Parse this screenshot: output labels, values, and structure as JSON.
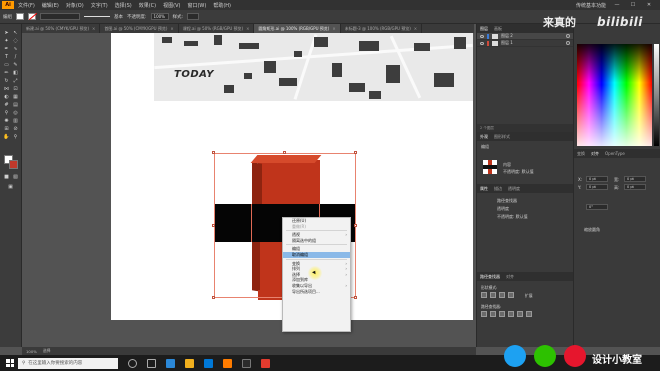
{
  "menubar": {
    "app_logo": "Ai",
    "items": [
      "文件(F)",
      "编辑(E)",
      "对象(O)",
      "文字(T)",
      "选择(S)",
      "效果(C)",
      "视图(V)",
      "窗口(W)",
      "帮助(H)"
    ],
    "workspace": "传统基本功能",
    "min": "—",
    "max": "☐",
    "close": "✕"
  },
  "control_bar": {
    "selection_label": "编组",
    "stroke_weight": "基本",
    "opacity_label": "不透明度:",
    "opacity": "100%",
    "style_label": "样式:"
  },
  "doc_tabs": [
    {
      "label": "新建.ai @ 50% (CMYK/GPU 预览)",
      "active": false
    },
    {
      "label": "首图.ai @ 50% (CMYK/GPU 预览)",
      "active": false
    },
    {
      "label": "课程.ai @ 50% (RGB/GPU 预览)",
      "active": false
    },
    {
      "label": "圆角矩形.ai @ 100% (RGB/GPU 预览)",
      "active": true
    },
    {
      "label": "未标题-3 @ 100% (RGB/GPU 预览)",
      "active": false
    }
  ],
  "tab_close": "×",
  "map_text": "TODAY",
  "context_menu": {
    "items": [
      {
        "label": "还原(U)",
        "disabled": false,
        "submenu": false
      },
      {
        "label": "重做(R)",
        "disabled": true,
        "submenu": false
      },
      {
        "sep": true
      },
      {
        "label": "透视",
        "disabled": false,
        "submenu": true
      },
      {
        "label": "隔离选中的组",
        "disabled": false,
        "submenu": false
      },
      {
        "sep": true
      },
      {
        "label": "编组",
        "disabled": false,
        "submenu": false
      },
      {
        "label": "取消编组",
        "disabled": false,
        "submenu": false,
        "highlight": true
      },
      {
        "sep": true
      },
      {
        "label": "变换",
        "disabled": false,
        "submenu": true
      },
      {
        "label": "排列",
        "disabled": false,
        "submenu": true
      },
      {
        "label": "选择",
        "disabled": false,
        "submenu": true
      },
      {
        "label": "添加到库",
        "disabled": false,
        "submenu": false
      },
      {
        "label": "收集以导出",
        "disabled": false,
        "submenu": true
      },
      {
        "label": "导出所选项目...",
        "disabled": false,
        "submenu": false
      }
    ],
    "arrow": "›"
  },
  "layers_panel": {
    "tabs": [
      "图层",
      "画板"
    ],
    "rows": [
      {
        "name": "图层 2",
        "selected": true
      },
      {
        "name": "图层 1",
        "selected": false
      }
    ],
    "footer": "2 个图层"
  },
  "appearance_panel": {
    "tabs": [
      "外观",
      "图形样式"
    ],
    "object": "编组",
    "contents": "内容",
    "opacity_row": "不透明度: 默认值",
    "sub_tabs": [
      "属性",
      "描边",
      "透明度"
    ],
    "item1": "路径查找器",
    "item2": "透明度",
    "item3": "不透明度: 默认值"
  },
  "transform_panel": {
    "tabs": [
      "变换",
      "对齐",
      "OpenType"
    ],
    "x_label": "X:",
    "x": "0 pt",
    "y_label": "Y:",
    "y": "0 pt",
    "w_label": "宽:",
    "w": "0 pt",
    "h_label": "高:",
    "h": "0 pt",
    "rotate": "0°",
    "checkbox": "缩放圆角"
  },
  "pathfinder_panel": {
    "tabs": [
      "路径查找器",
      "对齐"
    ],
    "shape_modes": "形状模式:",
    "pathfinders": "路径查找器:",
    "expand": "扩展"
  },
  "status_bar": {
    "zoom": "100%",
    "tool": "选择"
  },
  "taskbar": {
    "search_placeholder": "在这里输入你要搜索的内容"
  },
  "watermark": {
    "cn": "来真的",
    "bili": "bilibili",
    "label": "设计小教室"
  },
  "colors": {
    "object_red": "#c0341b",
    "object_black": "#050505",
    "menu_highlight": "#8ab9e8"
  }
}
